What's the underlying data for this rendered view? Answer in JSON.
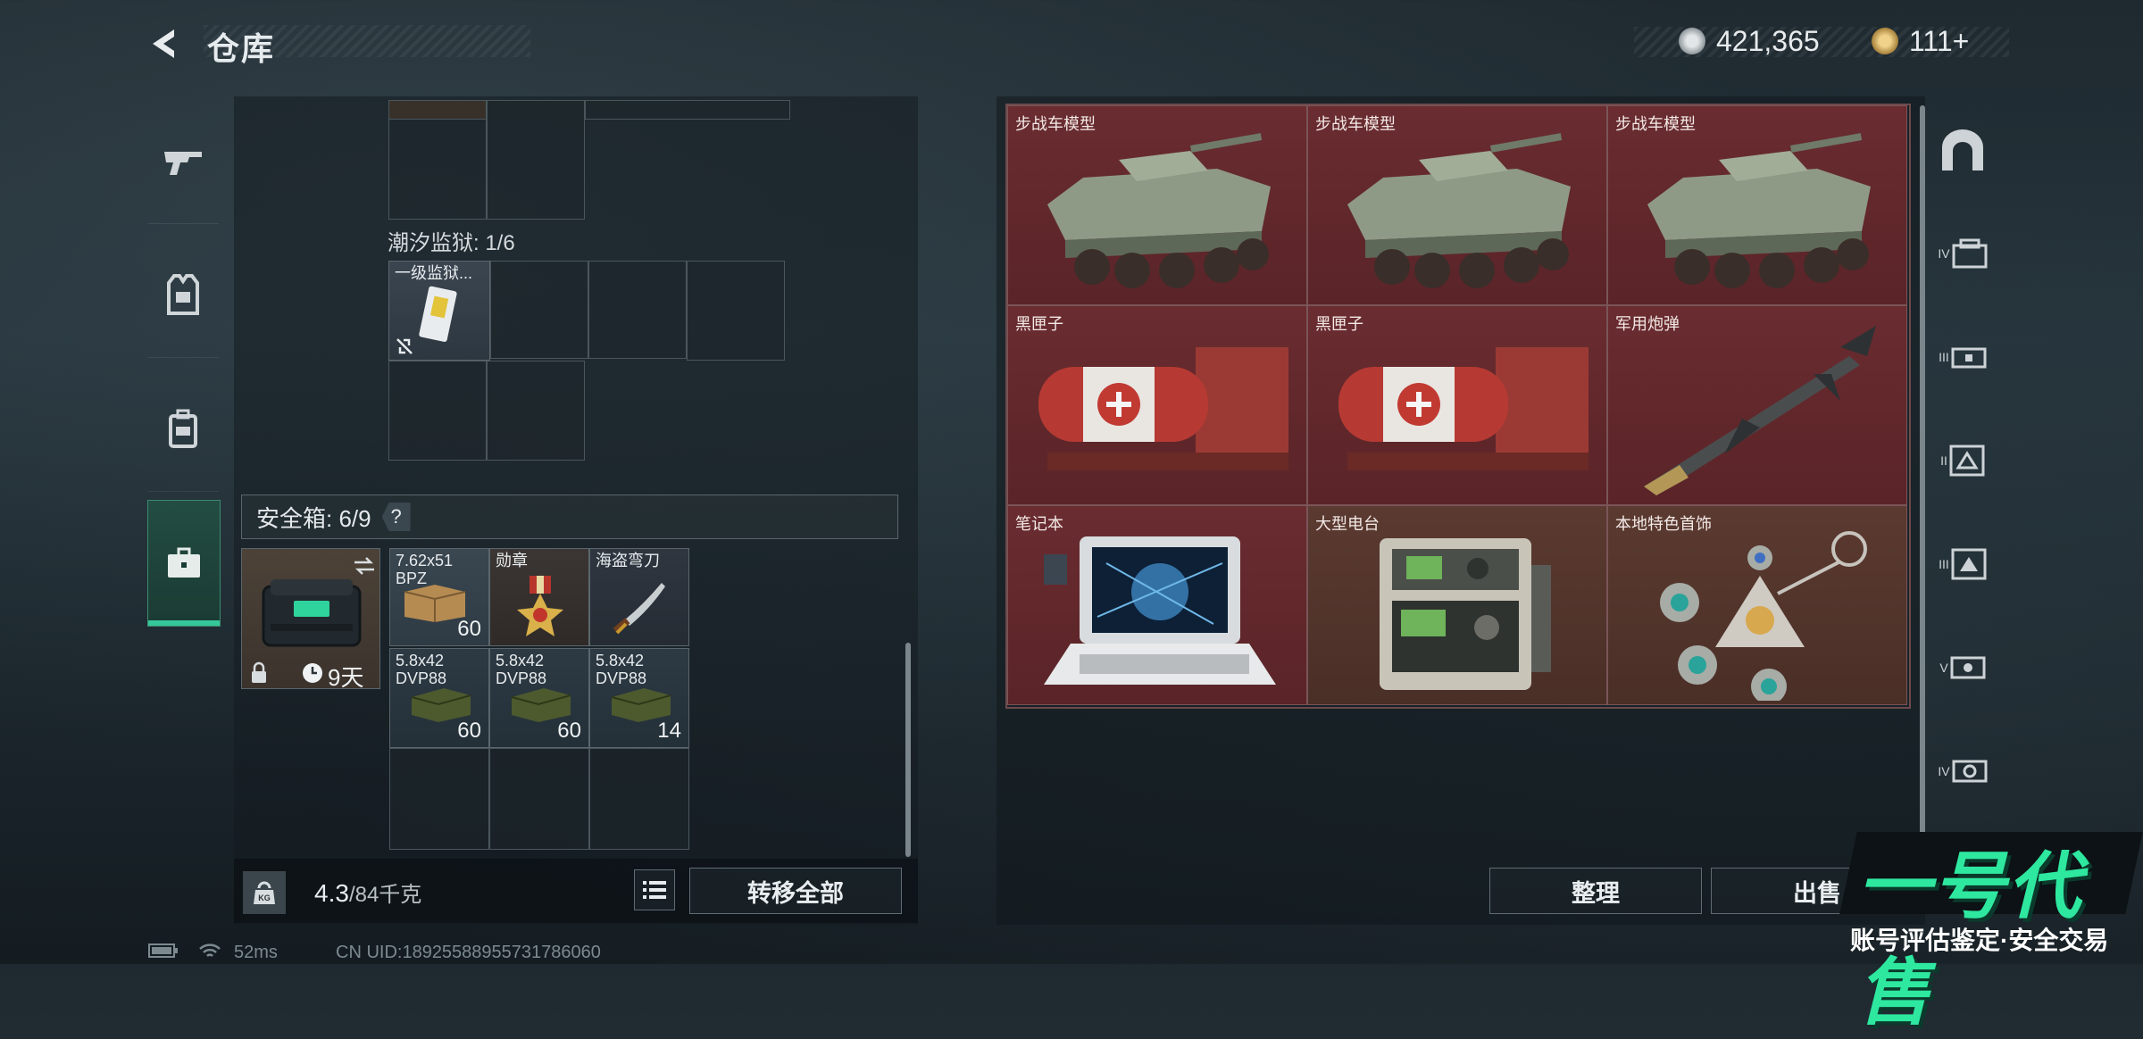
{
  "header": {
    "title": "仓库",
    "currency_1": "421,365",
    "currency_2": "111+",
    "plus_mark": "+"
  },
  "categories": [
    {
      "icon": "rifle-icon"
    },
    {
      "icon": "armor-vest-icon"
    },
    {
      "icon": "backpack-icon"
    },
    {
      "icon": "briefcase-icon",
      "active": true
    }
  ],
  "backpack": {
    "tide_prison_label": "潮汐监狱: 1/6",
    "tide_item_name": "一级监狱...",
    "safe_box_label": "安全箱: 6/9",
    "help": "?",
    "safe_box_timer": "9天",
    "safe_items": [
      {
        "name": "7.62x51\nBPZ",
        "count": "60"
      },
      {
        "name": "勋章",
        "count": ""
      },
      {
        "name": "海盗弯刀",
        "count": ""
      },
      {
        "name": "5.8x42\nDVP88",
        "count": "60"
      },
      {
        "name": "5.8x42\nDVP88",
        "count": "60"
      },
      {
        "name": "5.8x42\nDVP88",
        "count": "14"
      }
    ],
    "weight": "4.3",
    "weight_max": "/84千克",
    "weight_icon_label": "KG",
    "transfer_all": "转移全部"
  },
  "stash": {
    "items": [
      {
        "name": "步战车模型"
      },
      {
        "name": "步战车模型"
      },
      {
        "name": "步战车模型"
      },
      {
        "name": "黑匣子"
      },
      {
        "name": "黑匣子"
      },
      {
        "name": "军用炮弹"
      },
      {
        "name": "笔记本"
      },
      {
        "name": "大型电台"
      },
      {
        "name": "本地特色首饰"
      }
    ],
    "organize": "整理",
    "sell": "出售"
  },
  "right_rail": [
    {
      "icon": "arch-icon",
      "label": ""
    },
    {
      "icon": "tier-4-case-icon",
      "label": "IV"
    },
    {
      "icon": "tier-3-case-icon",
      "label": "III"
    },
    {
      "icon": "tier-2-case-icon",
      "label": "II"
    },
    {
      "icon": "tier-3-box-icon",
      "label": "III"
    },
    {
      "icon": "tier-5-box-icon",
      "label": "V"
    },
    {
      "icon": "tier-4-box-icon",
      "label": "IV"
    }
  ],
  "status": {
    "ping": "52ms",
    "uid": "CN UID:18925588955731786060"
  },
  "watermark": {
    "logo": "一号代售",
    "subtitle": "账号评估鉴定·安全交易"
  },
  "colors": {
    "accent_green": "#36c89a",
    "stash_red": "#6a2c30",
    "stash_brown": "#5b3a30",
    "watermark_green": "#2ee8a0"
  }
}
